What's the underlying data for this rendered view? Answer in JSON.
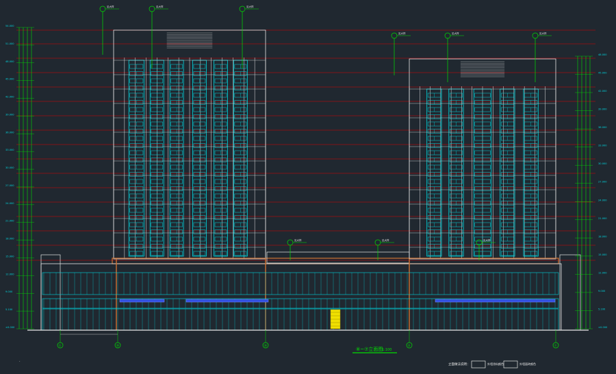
{
  "colors": {
    "background": "#202830",
    "outline": "#e8e8e8",
    "glass": "#00d8e0",
    "level_line": "#e00000",
    "callout": "#00e000",
    "podium_band": "#d07030",
    "accent_door": "#f0e000",
    "grid_bubble": "#00e000"
  },
  "drawing": {
    "title": "⑧~⑦立面图",
    "scale": "1:100"
  },
  "left_elevation_column": {
    "labels": [
      "54.000",
      "51.000",
      "48.000",
      "45.000",
      "42.000",
      "39.000",
      "36.000",
      "33.000",
      "30.000",
      "27.000",
      "24.000",
      "21.000",
      "18.000",
      "15.000",
      "12.000",
      "9.000",
      "5.100",
      "±0.000"
    ]
  },
  "right_elevation_column": {
    "labels": [
      "48.000",
      "45.000",
      "42.000",
      "39.000",
      "36.000",
      "33.000",
      "30.000",
      "27.000",
      "24.000",
      "21.000",
      "18.000",
      "15.000",
      "12.000",
      "9.000",
      "5.100",
      "±0.000"
    ]
  },
  "grid_axes": [
    "①",
    "⑳",
    "㉚",
    "⑤",
    "⑦"
  ],
  "bottom_notes": [
    "立面做法说明：",
    "外墙涂料颜色",
    "外墙面砖颜色"
  ],
  "callouts_top_left": [
    "见大样",
    "见大样",
    "见大样"
  ],
  "callouts_top_right": [
    "见大样",
    "见大样",
    "见大样"
  ],
  "podium_callouts": [
    "见大样",
    "见大样",
    "见大样"
  ]
}
